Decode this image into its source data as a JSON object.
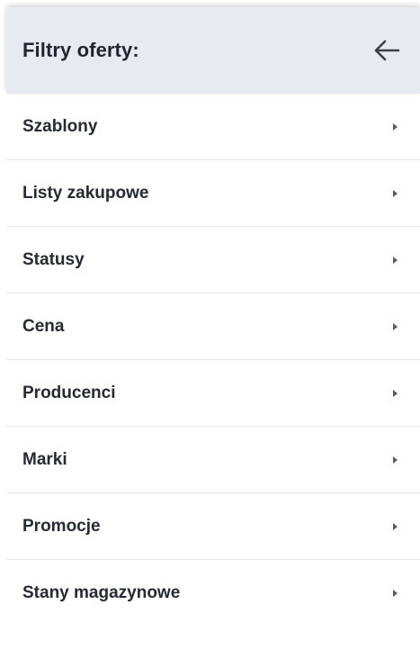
{
  "header": {
    "title": "Filtry oferty:",
    "back_icon": "arrow-left-icon"
  },
  "filters": [
    {
      "label": "Szablony",
      "icon": "chevron-right-icon"
    },
    {
      "label": "Listy zakupowe",
      "icon": "chevron-right-icon"
    },
    {
      "label": "Statusy",
      "icon": "chevron-right-icon"
    },
    {
      "label": "Cena",
      "icon": "chevron-right-icon"
    },
    {
      "label": "Producenci",
      "icon": "chevron-right-icon"
    },
    {
      "label": "Marki",
      "icon": "chevron-right-icon"
    },
    {
      "label": "Promocje",
      "icon": "chevron-right-icon"
    },
    {
      "label": "Stany magazynowe",
      "icon": "chevron-right-icon"
    }
  ],
  "colors": {
    "header_bg": "#e7ebf1",
    "text": "#262a33",
    "divider": "#e3e6ea"
  }
}
